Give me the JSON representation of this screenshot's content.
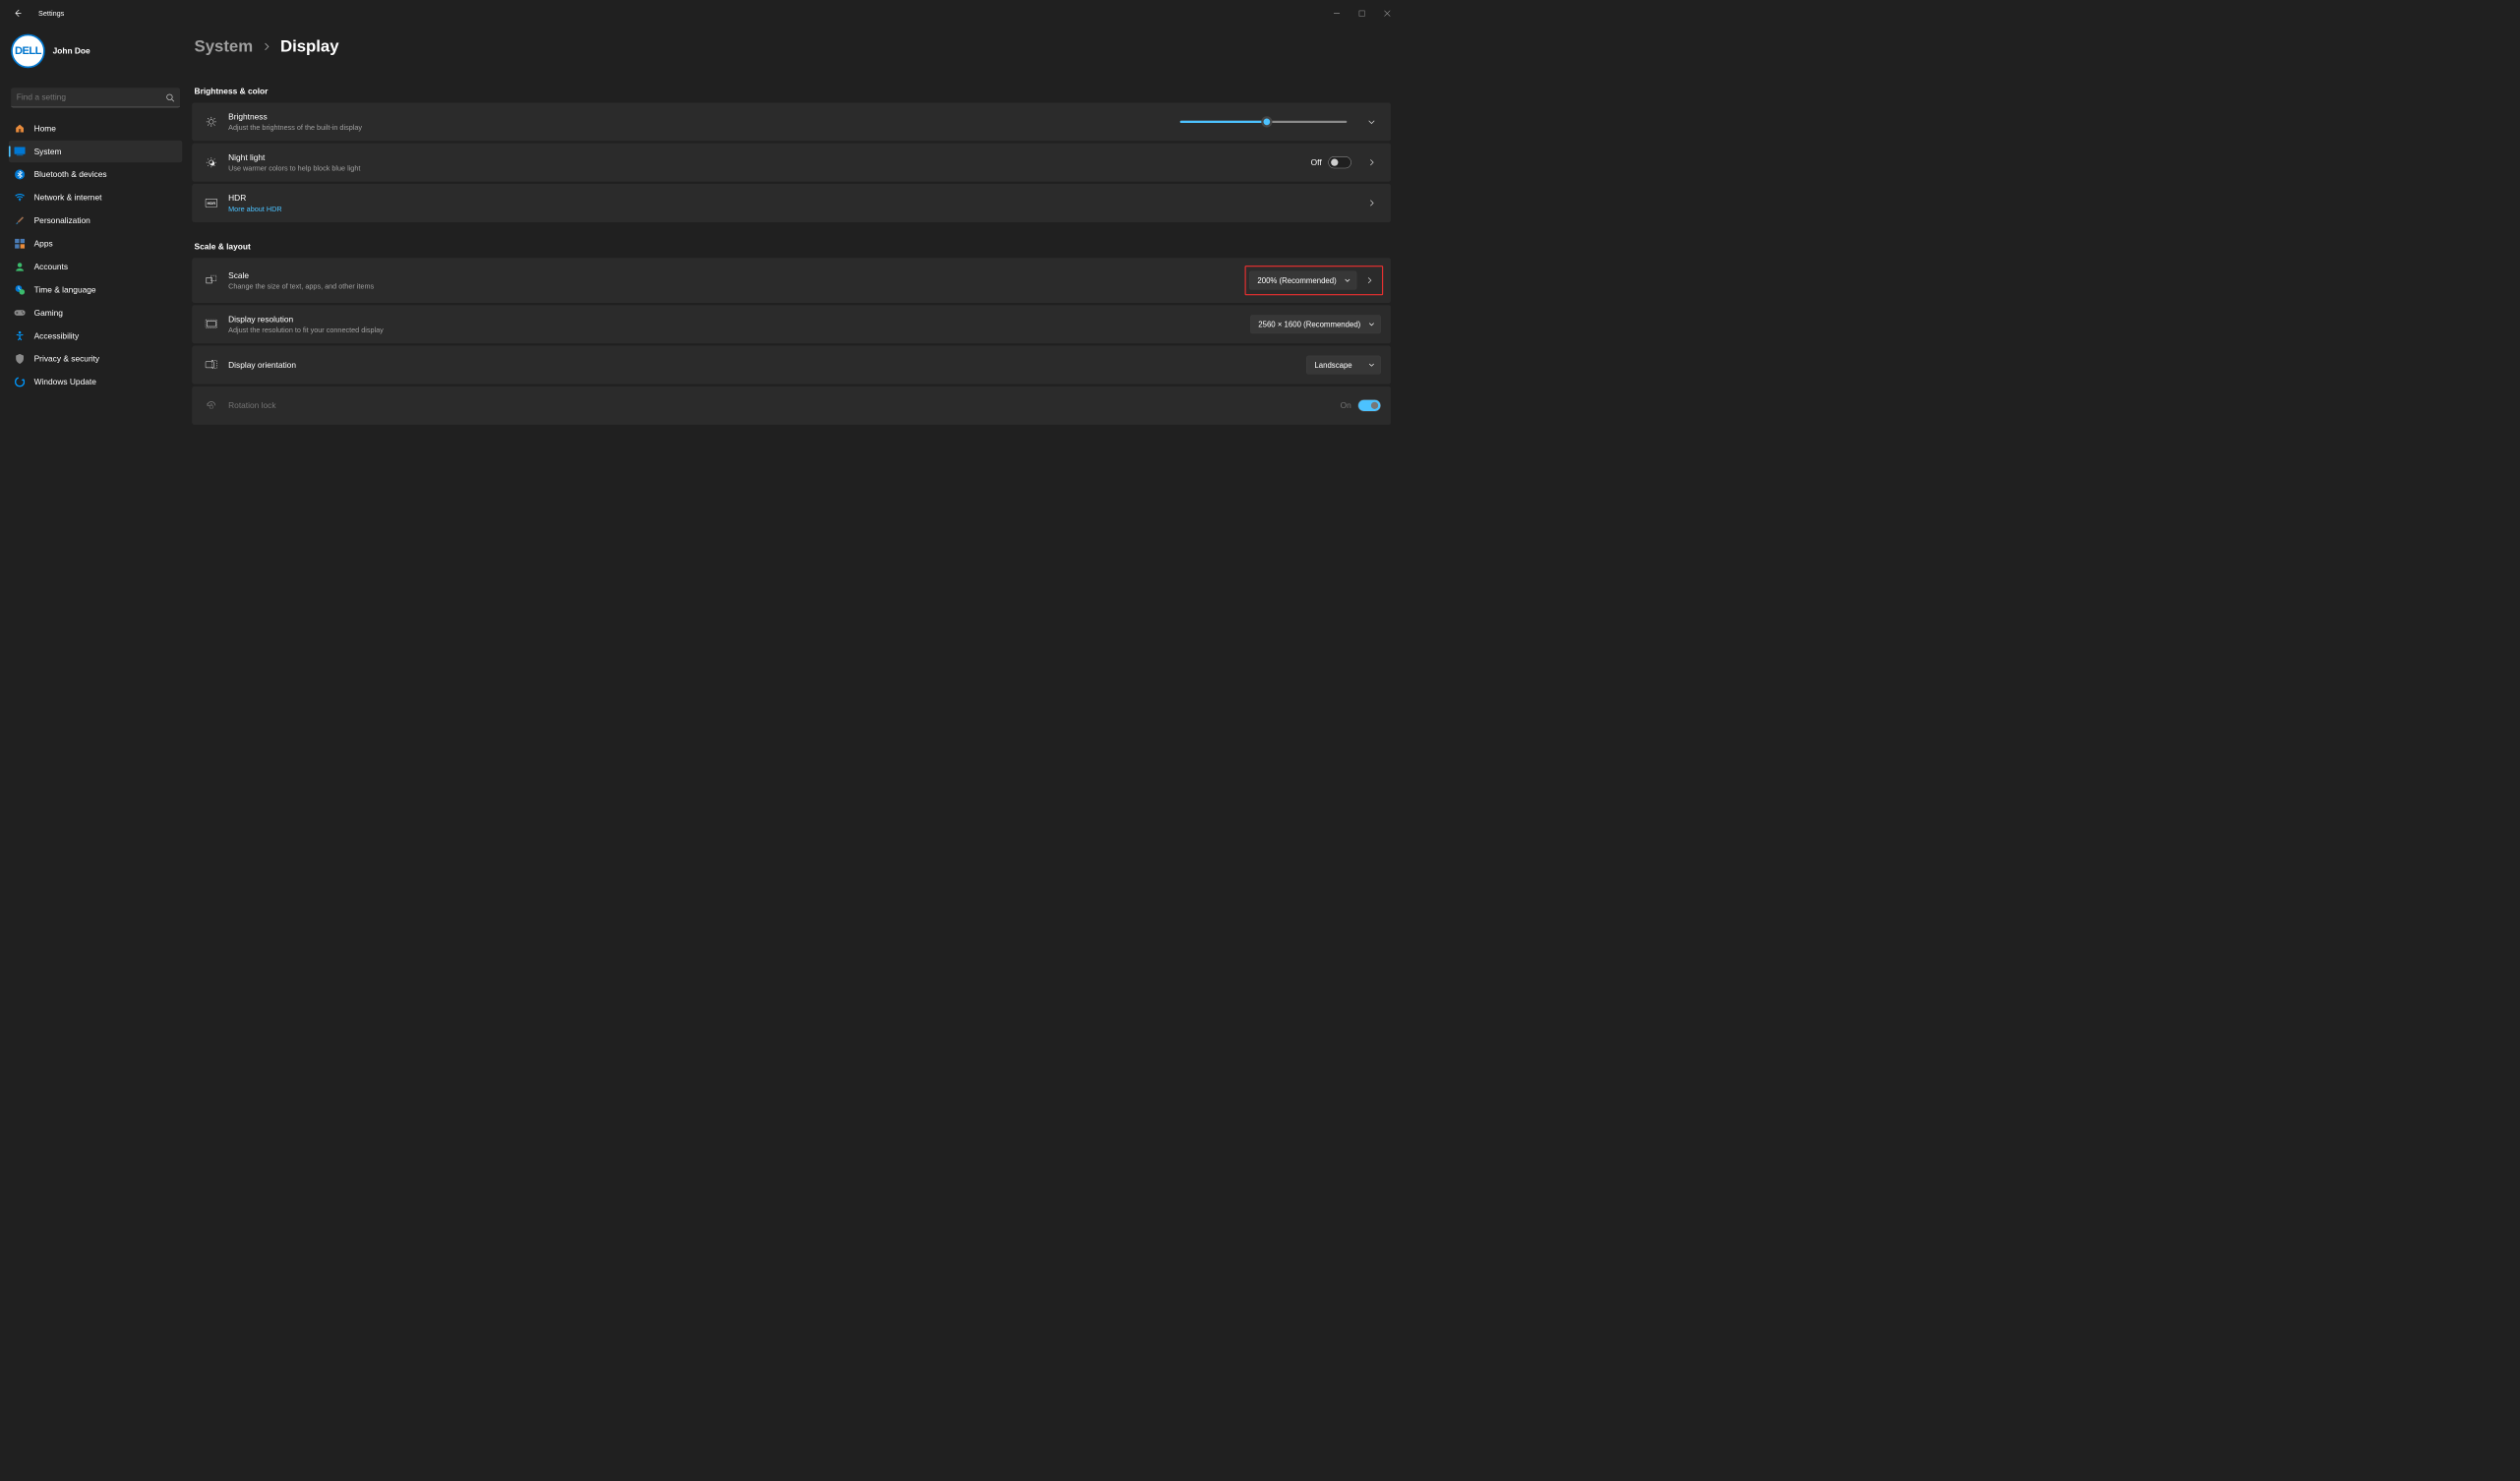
{
  "app": {
    "title": "Settings"
  },
  "user": {
    "name": "John Doe",
    "avatar_text": "DELL"
  },
  "search": {
    "placeholder": "Find a setting"
  },
  "nav": {
    "items": [
      {
        "label": "Home"
      },
      {
        "label": "System"
      },
      {
        "label": "Bluetooth & devices"
      },
      {
        "label": "Network & internet"
      },
      {
        "label": "Personalization"
      },
      {
        "label": "Apps"
      },
      {
        "label": "Accounts"
      },
      {
        "label": "Time & language"
      },
      {
        "label": "Gaming"
      },
      {
        "label": "Accessibility"
      },
      {
        "label": "Privacy & security"
      },
      {
        "label": "Windows Update"
      }
    ],
    "active_index": 1
  },
  "breadcrumb": {
    "parent": "System",
    "current": "Display"
  },
  "sections": {
    "brightness_color": {
      "title": "Brightness & color",
      "brightness": {
        "title": "Brightness",
        "sub": "Adjust the brightness of the built-in display",
        "value_pct": 52
      },
      "night_light": {
        "title": "Night light",
        "sub": "Use warmer colors to help block blue light",
        "state_label": "Off",
        "on": false
      },
      "hdr": {
        "title": "HDR",
        "link": "More about HDR"
      }
    },
    "scale_layout": {
      "title": "Scale & layout",
      "scale": {
        "title": "Scale",
        "sub": "Change the size of text, apps, and other items",
        "value": "200% (Recommended)"
      },
      "resolution": {
        "title": "Display resolution",
        "sub": "Adjust the resolution to fit your connected display",
        "value": "2560 × 1600 (Recommended)"
      },
      "orientation": {
        "title": "Display orientation",
        "value": "Landscape"
      },
      "rotation_lock": {
        "title": "Rotation lock",
        "state_label": "On",
        "on": true,
        "disabled": true
      }
    }
  }
}
